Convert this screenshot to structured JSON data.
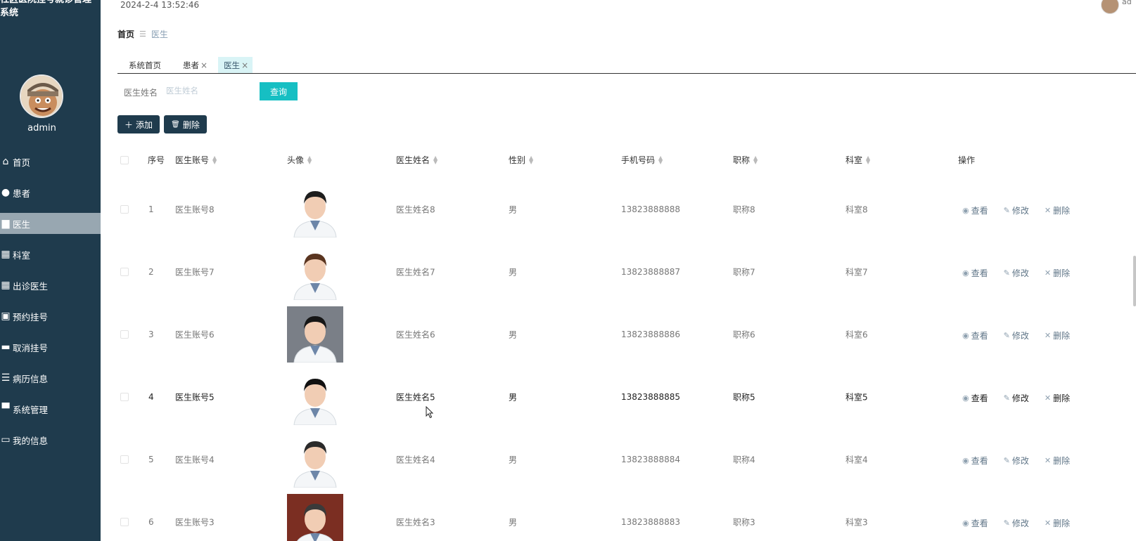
{
  "app": {
    "title": "社区医院挂号就诊管理系统"
  },
  "user": {
    "name": "admin",
    "top_name": "ad"
  },
  "datetime": "2024-2-4 13:52:46",
  "menu": [
    {
      "label": "首页",
      "icon": "home-icon",
      "glyph": "⌂"
    },
    {
      "label": "患者",
      "icon": "user-icon",
      "glyph": "●"
    },
    {
      "label": "医生",
      "icon": "doctor-card-icon",
      "glyph": "▆",
      "active": true
    },
    {
      "label": "科室",
      "icon": "grid-icon",
      "glyph": "▦"
    },
    {
      "label": "出诊医生",
      "icon": "grid-icon",
      "glyph": "▦"
    },
    {
      "label": "预约挂号",
      "icon": "clipboard-icon",
      "glyph": "▣"
    },
    {
      "label": "取消挂号",
      "icon": "monitor-icon",
      "glyph": "▬"
    },
    {
      "label": "病历信息",
      "icon": "sliders-icon",
      "glyph": "☰"
    },
    {
      "label": "系统管理",
      "icon": "sign-icon",
      "glyph": "▀"
    },
    {
      "label": "我的信息",
      "icon": "wallet-icon",
      "glyph": "▭"
    }
  ],
  "breadcrumb": {
    "home": "首页",
    "sep": "☰",
    "current": "医生"
  },
  "tabs": [
    {
      "label": "系统首页",
      "closable": false
    },
    {
      "label": "患者",
      "closable": true
    },
    {
      "label": "医生",
      "closable": true,
      "active": true
    }
  ],
  "search": {
    "label": "医生姓名",
    "placeholder": "医生姓名",
    "button": "查询"
  },
  "actions": {
    "add": "添加",
    "delete": "删除"
  },
  "table": {
    "columns": [
      "序号",
      "医生账号",
      "头像",
      "医生姓名",
      "性别",
      "手机号码",
      "职称",
      "科室",
      "操作"
    ],
    "ops": {
      "view": "查看",
      "edit": "修改",
      "delete": "删除"
    },
    "rows": [
      {
        "index": "1",
        "account": "医生账号8",
        "name": "医生姓名8",
        "gender": "男",
        "phone": "13823888888",
        "title": "职称8",
        "dept": "科室8"
      },
      {
        "index": "2",
        "account": "医生账号7",
        "name": "医生姓名7",
        "gender": "男",
        "phone": "13823888887",
        "title": "职称7",
        "dept": "科室7"
      },
      {
        "index": "3",
        "account": "医生账号6",
        "name": "医生姓名6",
        "gender": "男",
        "phone": "13823888886",
        "title": "职称6",
        "dept": "科室6"
      },
      {
        "index": "4",
        "account": "医生账号5",
        "name": "医生姓名5",
        "gender": "男",
        "phone": "13823888885",
        "title": "职称5",
        "dept": "科室5"
      },
      {
        "index": "5",
        "account": "医生账号4",
        "name": "医生姓名4",
        "gender": "男",
        "phone": "13823888884",
        "title": "职称4",
        "dept": "科室4"
      },
      {
        "index": "6",
        "account": "医生账号3",
        "name": "医生姓名3",
        "gender": "男",
        "phone": "13823888883",
        "title": "职称3",
        "dept": "科室3"
      }
    ]
  },
  "colors": {
    "sidebar": "#1f3b4d",
    "accent": "#16bfc3",
    "active_menu": "#98a7b1",
    "active_tab": "#d9f4f6"
  }
}
